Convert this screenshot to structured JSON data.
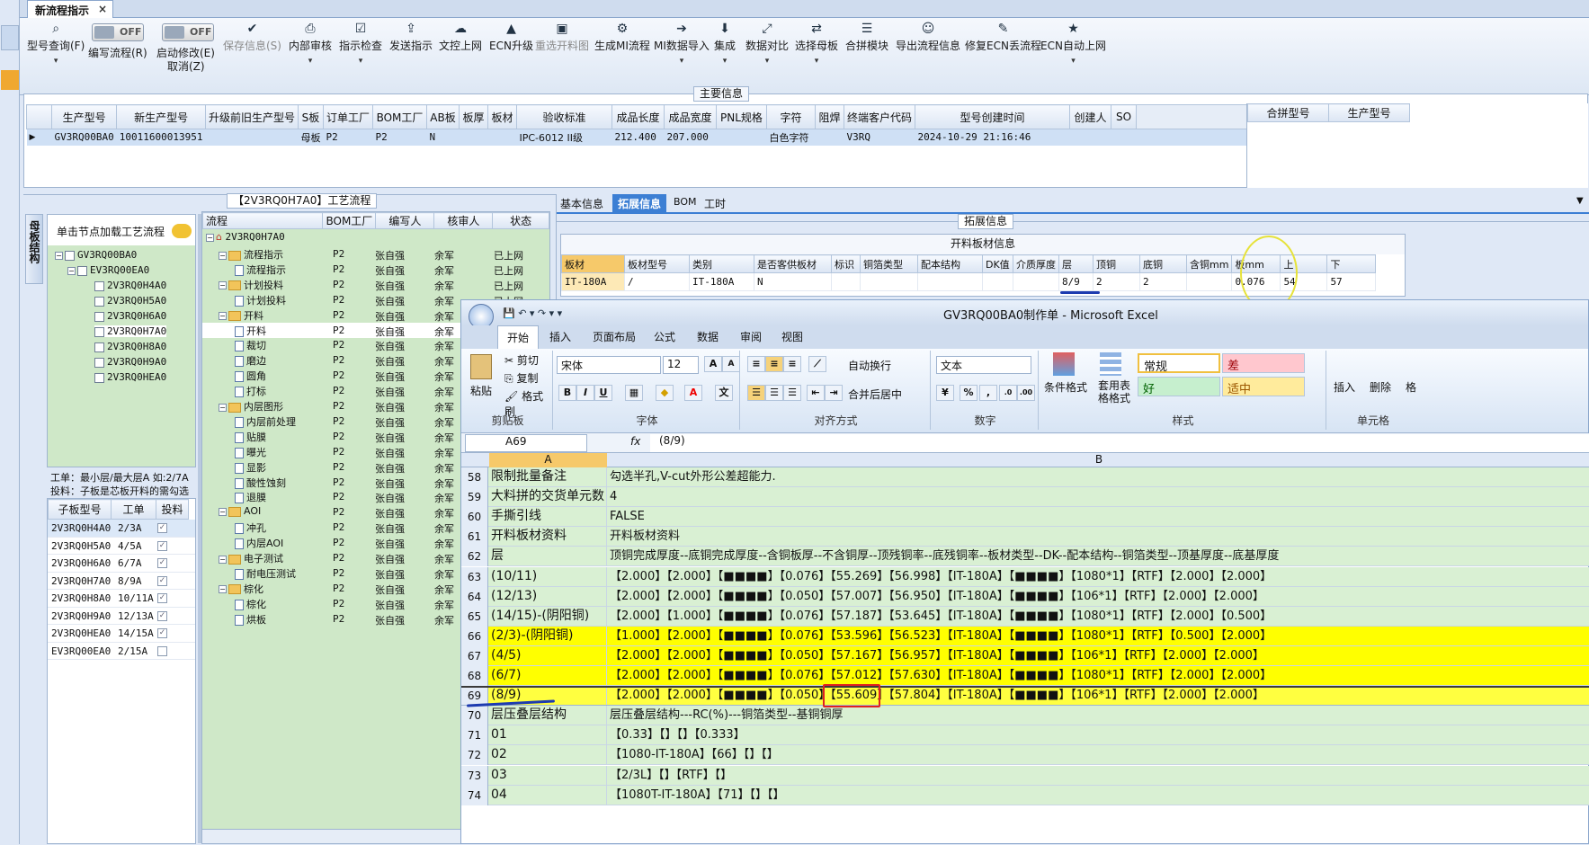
{
  "tab": {
    "title": "新流程指示",
    "close": "×"
  },
  "toolbar": {
    "items": [
      {
        "label": "型号查询(F)",
        "icon": "search-icon"
      },
      {
        "toggle": "OFF",
        "label": "编写流程(R)"
      },
      {
        "toggle": "OFF",
        "label": "启动修改(E)",
        "sub": "取消(Z)"
      },
      {
        "label": "保存信息(S)",
        "icon": "check-icon",
        "disabled": true
      },
      {
        "label": "内部审核",
        "icon": "print-icon"
      },
      {
        "label": "指示检查",
        "icon": "check-box-icon"
      },
      {
        "label": "发送指示",
        "icon": "upload-icon"
      },
      {
        "label": "文控上网",
        "icon": "cloud-upload-icon"
      },
      {
        "label": "ECN升级",
        "icon": "ecn-icon"
      },
      {
        "label": "重选开料图",
        "icon": "image-icon",
        "disabled": true
      },
      {
        "label": "生成MI流程",
        "icon": "gears-icon"
      },
      {
        "label": "MI数据导入",
        "icon": "import-icon"
      },
      {
        "label": "集成",
        "icon": "download-icon"
      },
      {
        "label": "数据对比",
        "icon": "compare-icon"
      },
      {
        "label": "选择母板",
        "icon": "shuffle-icon"
      },
      {
        "label": "合拼模块",
        "icon": "list-icon"
      },
      {
        "label": "导出流程信息",
        "icon": "smile-icon"
      },
      {
        "label": "修复ECN丢流程",
        "icon": "wrench-icon"
      },
      {
        "label": "ECN自动上网",
        "icon": "star-icon"
      }
    ]
  },
  "main_info": {
    "title": "主要信息",
    "columns": [
      "生产型号",
      "新生产型号",
      "升级前旧生产型号",
      "S板",
      "订单工厂",
      "BOM工厂",
      "AB板",
      "板厚",
      "板材",
      "验收标准",
      "成品长度",
      "成品宽度",
      "PNL规格",
      "字符",
      "阻焊",
      "终端客户代码",
      "型号创建时间",
      "创建人",
      "SO"
    ],
    "row": [
      "GV3RQ00BA0",
      "10011600013951",
      "",
      "母板",
      "P2",
      "P2",
      "N",
      "",
      "",
      "IPC-6012 II级",
      "212.400",
      "207.000",
      "",
      "白色字符",
      "",
      "V3RQ",
      "2024-10-29 21:16:46",
      "",
      ""
    ],
    "right_columns": [
      "合拼型号",
      "生产型号"
    ]
  },
  "left_panel": {
    "vtab": "母板结构",
    "hint": "单击节点加载工艺流程",
    "tree": [
      "GV3RQ00BA0",
      "EV3RQ00EA0",
      "2V3RQ0H4A0",
      "2V3RQ0H5A0",
      "2V3RQ0H6A0",
      "2V3RQ0H7A0",
      "2V3RQ0H8A0",
      "2V3RQ0H9A0",
      "2V3RQ0HEA0"
    ],
    "note1": "工单：最小层/最大层A 如:2/7A",
    "note2": "投料：子板是芯板开料的需勾选",
    "sub_columns": [
      "子板型号",
      "工单",
      "投料"
    ],
    "sub_rows": [
      [
        "2V3RQ0H4A0",
        "2/3A",
        true
      ],
      [
        "2V3RQ0H5A0",
        "4/5A",
        true
      ],
      [
        "2V3RQ0H6A0",
        "6/7A",
        true
      ],
      [
        "2V3RQ0H7A0",
        "8/9A",
        true
      ],
      [
        "2V3RQ0H8A0",
        "10/11A",
        true
      ],
      [
        "2V3RQ0H9A0",
        "12/13A",
        true
      ],
      [
        "2V3RQ0HEA0",
        "14/15A",
        true
      ],
      [
        "EV3RQ00EA0",
        "2/15A",
        false
      ]
    ]
  },
  "process": {
    "title": "【2V3RQ0H7A0】工艺流程",
    "columns": [
      "流程",
      "BOM工厂",
      "编写人",
      "核审人",
      "状态"
    ],
    "root": "2V3RQ0H7A0",
    "rows": [
      {
        "name": "流程指示",
        "lvl": 1,
        "f": "P2",
        "w": "张自强",
        "r": "余军",
        "s": "已上网"
      },
      {
        "name": "流程指示",
        "lvl": 2,
        "f": "P2",
        "w": "张自强",
        "r": "余军",
        "s": "已上网"
      },
      {
        "name": "计划投料",
        "lvl": 1,
        "f": "P2",
        "w": "张自强",
        "r": "余军",
        "s": "已上网"
      },
      {
        "name": "计划投料",
        "lvl": 2,
        "f": "P2",
        "w": "张自强",
        "r": "余军",
        "s": "已上网"
      },
      {
        "name": "开料",
        "lvl": 1,
        "f": "P2",
        "w": "张自强",
        "r": "余军",
        "s": ""
      },
      {
        "name": "开料",
        "lvl": 2,
        "f": "P2",
        "w": "张自强",
        "r": "余军",
        "s": ""
      },
      {
        "name": "裁切",
        "lvl": 2,
        "f": "P2",
        "w": "张自强",
        "r": "余军",
        "s": ""
      },
      {
        "name": "磨边",
        "lvl": 2,
        "f": "P2",
        "w": "张自强",
        "r": "余军",
        "s": ""
      },
      {
        "name": "圆角",
        "lvl": 2,
        "f": "P2",
        "w": "张自强",
        "r": "余军",
        "s": ""
      },
      {
        "name": "打标",
        "lvl": 2,
        "f": "P2",
        "w": "张自强",
        "r": "余军",
        "s": ""
      },
      {
        "name": "内层图形",
        "lvl": 1,
        "f": "P2",
        "w": "张自强",
        "r": "余军",
        "s": ""
      },
      {
        "name": "内层前处理",
        "lvl": 2,
        "f": "P2",
        "w": "张自强",
        "r": "余军",
        "s": ""
      },
      {
        "name": "贴膜",
        "lvl": 2,
        "f": "P2",
        "w": "张自强",
        "r": "余军",
        "s": ""
      },
      {
        "name": "曝光",
        "lvl": 2,
        "f": "P2",
        "w": "张自强",
        "r": "余军",
        "s": ""
      },
      {
        "name": "显影",
        "lvl": 2,
        "f": "P2",
        "w": "张自强",
        "r": "余军",
        "s": ""
      },
      {
        "name": "酸性蚀刻",
        "lvl": 2,
        "f": "P2",
        "w": "张自强",
        "r": "余军",
        "s": ""
      },
      {
        "name": "退膜",
        "lvl": 2,
        "f": "P2",
        "w": "张自强",
        "r": "余军",
        "s": ""
      },
      {
        "name": "AOI",
        "lvl": 1,
        "f": "P2",
        "w": "张自强",
        "r": "余军",
        "s": ""
      },
      {
        "name": "冲孔",
        "lvl": 2,
        "f": "P2",
        "w": "张自强",
        "r": "余军",
        "s": ""
      },
      {
        "name": "内层AOI",
        "lvl": 2,
        "f": "P2",
        "w": "张自强",
        "r": "余军",
        "s": ""
      },
      {
        "name": "电子测试",
        "lvl": 1,
        "f": "P2",
        "w": "张自强",
        "r": "余军",
        "s": ""
      },
      {
        "name": "耐电压测试",
        "lvl": 2,
        "f": "P2",
        "w": "张自强",
        "r": "余军",
        "s": ""
      },
      {
        "name": "棕化",
        "lvl": 1,
        "f": "P2",
        "w": "张自强",
        "r": "余军",
        "s": ""
      },
      {
        "name": "棕化",
        "lvl": 2,
        "f": "P2",
        "w": "张自强",
        "r": "余军",
        "s": ""
      },
      {
        "name": "烘板",
        "lvl": 2,
        "f": "P2",
        "w": "张自强",
        "r": "余军",
        "s": ""
      }
    ]
  },
  "right_tabs": [
    "基本信息",
    "拓展信息",
    "BOM",
    "工时"
  ],
  "ext": {
    "title": "拓展信息",
    "sub_title": "开料板材信息",
    "columns": [
      "板材",
      "板材型号",
      "类别",
      "是否客供板材",
      "标识",
      "铜箔类型",
      "配本结构",
      "DK值",
      "介质厚度",
      "层",
      "顶铜",
      "底铜",
      "含铜mm",
      "板mm",
      "上",
      "下"
    ],
    "row": [
      "IT-180A",
      "/",
      "IT-180A",
      "N",
      "",
      "",
      "",
      "",
      "",
      "8/9",
      "2",
      "2",
      "",
      "0.076",
      "54",
      "57"
    ]
  },
  "excel": {
    "title": "GV3RQ00BA0制作单 - Microsoft Excel",
    "tabs": [
      "开始",
      "插入",
      "页面布局",
      "公式",
      "数据",
      "审阅",
      "视图"
    ],
    "paste": "粘贴",
    "cut": "剪切",
    "copy": "复制",
    "fmt": "格式刷",
    "clip": "剪贴板",
    "font_name": "宋体",
    "font_size": "12",
    "font_group": "字体",
    "wrap": "自动换行",
    "merge": "合并后居中",
    "align_group": "对齐方式",
    "numfmt": "文本",
    "num_group": "数字",
    "cond": "条件格式",
    "tablefmt": "套用表格格式",
    "styles": [
      "常规",
      "差",
      "好",
      "适中"
    ],
    "style_group": "样式",
    "insert": "插入",
    "delete": "删除",
    "cells_group": "单元格",
    "more": "格",
    "namebox": "A69",
    "fx": "fx",
    "formula": "(8/9)",
    "colA": "A",
    "colB": "B",
    "rows": [
      {
        "n": "58",
        "a": "限制批量备注",
        "b": "勾选半孔,V-cut外形公差超能力.",
        "y": false
      },
      {
        "n": "59",
        "a": "大料拼的交货单元数",
        "b": "4",
        "y": false
      },
      {
        "n": "60",
        "a": "手撕引线",
        "b": "FALSE",
        "y": false
      },
      {
        "n": "61",
        "a": "开料板材资料",
        "b": "开料板材资料",
        "y": false
      },
      {
        "n": "62",
        "a": "层",
        "b": "顶铜完成厚度--底铜完成厚度--含铜板厚--不含铜厚--顶残铜率--底残铜率--板材类型--DK--配本结构--铜箔类型--顶基厚度--底基厚度",
        "y": false
      },
      {
        "n": "63",
        "a": "(10/11)",
        "b": "【2.000】【2.000】【■■■■】【0.076】【55.269】【56.998】【IT-180A】【■■■■】【1080*1】【RTF】【2.000】【2.000】",
        "y": false
      },
      {
        "n": "64",
        "a": "(12/13)",
        "b": "【2.000】【2.000】【■■■■】【0.050】【57.007】【56.950】【IT-180A】【■■■■】【106*1】【RTF】【2.000】【2.000】",
        "y": false
      },
      {
        "n": "65",
        "a": "(14/15)-(阴阳铜)",
        "b": "【2.000】【1.000】【■■■■】【0.076】【57.187】【53.645】【IT-180A】【■■■■】【1080*1】【RTF】【2.000】【0.500】",
        "y": false
      },
      {
        "n": "66",
        "a": "(2/3)-(阴阳铜)",
        "b": "【1.000】【2.000】【■■■■】【0.076】【53.596】【56.523】【IT-180A】【■■■■】【1080*1】【RTF】【0.500】【2.000】",
        "y": true
      },
      {
        "n": "67",
        "a": "(4/5)",
        "b": "【2.000】【2.000】【■■■■】【0.050】【57.167】【56.957】【IT-180A】【■■■■】【106*1】【RTF】【2.000】【2.000】",
        "y": true
      },
      {
        "n": "68",
        "a": "(6/7)",
        "b": "【2.000】【2.000】【■■■■】【0.076】【57.012】【57.630】【IT-180A】【■■■■】【1080*1】【RTF】【2.000】【2.000】",
        "y": true
      },
      {
        "n": "69",
        "a": "(8/9)",
        "b": "【2.000】【2.000】【■■■■】【0.050】【55.609】【57.804】【IT-180A】【■■■■】【106*1】【RTF】【2.000】【2.000】",
        "y": true
      },
      {
        "n": "70",
        "a": "层压叠层结构",
        "b": "层压叠层结构---RC(%)---铜箔类型--基铜铜厚",
        "y": false
      },
      {
        "n": "71",
        "a": "01",
        "b": "【0.33】【】【】【0.333】",
        "y": false
      },
      {
        "n": "72",
        "a": "02",
        "b": "【1080-IT-180A】【66】【】【】",
        "y": false
      },
      {
        "n": "73",
        "a": "03",
        "b": "【2/3L】【】【RTF】【】",
        "y": false
      },
      {
        "n": "74",
        "a": "04",
        "b": "【1080T-IT-180A】【71】【】【】",
        "y": false
      }
    ]
  }
}
